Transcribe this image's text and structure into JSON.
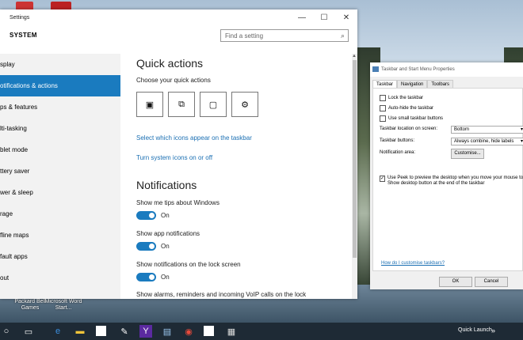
{
  "desktop": {
    "icons": [
      {
        "label": "Packard Bell Games",
        "icon": "game-icon"
      },
      {
        "label": "Microsoft Word Start...",
        "icon": "word-icon"
      }
    ]
  },
  "settings": {
    "window_title": "Settings",
    "window_controls": {
      "minimize": "—",
      "maximize": "☐",
      "close": "✕"
    },
    "section": "SYSTEM",
    "search_placeholder": "Find a setting",
    "nav": [
      {
        "label": "splay",
        "active": false
      },
      {
        "label": "otifications & actions",
        "active": true
      },
      {
        "label": "ps & features",
        "active": false
      },
      {
        "label": "lti-tasking",
        "active": false
      },
      {
        "label": "blet mode",
        "active": false
      },
      {
        "label": "ttery saver",
        "active": false
      },
      {
        "label": "wer & sleep",
        "active": false
      },
      {
        "label": "rage",
        "active": false
      },
      {
        "label": "fline maps",
        "active": false
      },
      {
        "label": "fault apps",
        "active": false
      },
      {
        "label": "out",
        "active": false
      }
    ],
    "quick_actions": {
      "heading": "Quick actions",
      "subheading": "Choose your quick actions",
      "tiles": [
        "tablet-mode-icon",
        "connect-icon",
        "note-icon",
        "settings-gear-icon"
      ],
      "link_icons": "Select which icons appear on the taskbar",
      "link_system": "Turn system icons on or off"
    },
    "notifications": {
      "heading": "Notifications",
      "toggles": [
        {
          "label": "Show me tips about Windows",
          "state": "On"
        },
        {
          "label": "Show app notifications",
          "state": "On"
        },
        {
          "label": "Show notifications on the lock screen",
          "state": "On"
        }
      ],
      "cut_off": "Show alarms, reminders and incoming VoIP calls on the lock"
    }
  },
  "props": {
    "title": "Taskbar and Start Menu Properties",
    "tabs": [
      "Taskbar",
      "Navigation",
      "Toolbars"
    ],
    "checkboxes": [
      {
        "label": "Lock the taskbar",
        "checked": false
      },
      {
        "label": "Auto-hide the taskbar",
        "checked": false
      },
      {
        "label": "Use small taskbar buttons",
        "checked": false
      }
    ],
    "location_label": "Taskbar location on screen:",
    "location_value": "Bottom",
    "buttons_label": "Taskbar buttons:",
    "buttons_value": "Always combine, hide labels",
    "notification_label": "Notification area:",
    "customise": "Customise...",
    "peek_label": "Use Peek to preview the desktop when you move your mouse to Show desktop button at the end of the taskbar",
    "help_link": "How do I customise taskbars?",
    "ok": "OK",
    "cancel": "Cancel"
  },
  "taskbar": {
    "quick_launch": "Quick Launch",
    "items": [
      "start-icon",
      "search-circle-icon",
      "task-view-icon",
      "edge-icon",
      "explorer-icon",
      "app-icon",
      "tool-icon",
      "yahoo-icon",
      "photos-icon",
      "chrome-icon",
      "settings-app-icon",
      "props-app-icon"
    ]
  }
}
